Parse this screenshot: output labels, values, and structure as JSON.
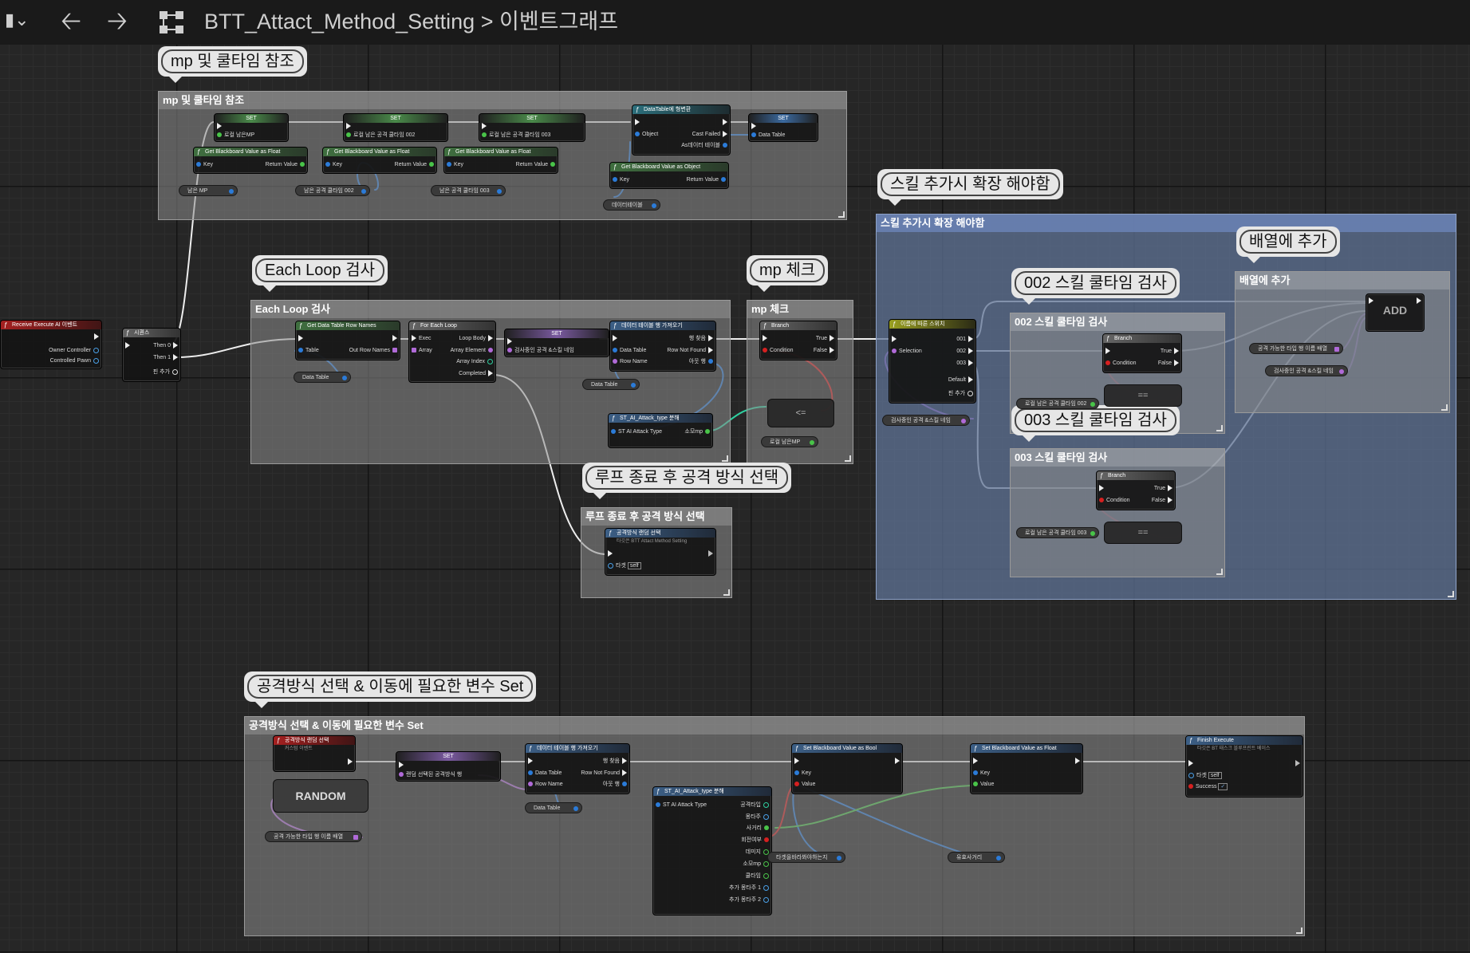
{
  "header": {
    "bookmark_icon": "bookmark-icon",
    "back_icon": "arrow-left-icon",
    "forward_icon": "arrow-right-icon",
    "graph_icon": "graph-icon",
    "breadcrumb_root": "BTT_Attact_Method_Setting",
    "breadcrumb_sep": ">",
    "breadcrumb_current": "이벤트그래프"
  },
  "comments": {
    "mp": "mp 및 쿨타임 참조",
    "each_loop": "Each Loop 검사",
    "mp_check": "mp 체크",
    "skill_extend": "스킬 추가시 확장 해야함",
    "add_array": "배열에 추가",
    "skill002": "002 스킬 쿨타임 검사",
    "skill003": "003 스킬 쿨타임 검사",
    "loop_end": "루프 종료 후 공격 방식 선택",
    "bottom": "공격방식 선택 & 이동에 필요한 변수 Set"
  },
  "nodes": {
    "receive_event": "Receive Execute AI 이벤트",
    "owner_controller": "Owner Controller",
    "controlled_pawn": "Controlled Pawn",
    "sequence": "시퀀스",
    "then0": "Then 0",
    "then1": "Then 1",
    "add_pin": "핀 추가",
    "set": "SET",
    "set_hp": "로컬 남은MP",
    "set_cd002": "로컬 남은 공격 쿨타임 002",
    "set_cd003": "로컬 남은 공격 쿨타임 003",
    "get_bb_float": "Get Blackboard Value as Float",
    "get_bb_object": "Get Blackboard Value as Object",
    "key": "Key",
    "return_value": "Return Value",
    "var_mp": "남은 MP",
    "var_cd002": "남은 공격 쿨타임 002",
    "var_cd003": "남은 공격 쿨타임 003",
    "var_dt": "데이터테이블",
    "cast_dt": "DataTable에 형변환",
    "object": "Object",
    "cast_failed": "Cast Failed",
    "as_dt": "As데이터 테이블",
    "data_table": "Data Table",
    "get_row_names": "Get Data Table Row Names",
    "table": "Table",
    "out_row_names": "Out Row Names",
    "for_each": "For Each Loop",
    "exec": "Exec",
    "array": "Array",
    "loop_body": "Loop Body",
    "array_element": "Array Element",
    "array_index": "Array Index",
    "completed": "Completed",
    "set_check_type": "검사중인 공격 &스킬 네임",
    "get_dt_row": "데이터 테이블 행 가져오기",
    "row_found": "행 찾음",
    "row_not_found": "Row Not Found",
    "row_name": "Row Name",
    "out_row": "아웃 행",
    "break_struct": "ST_AI_Attack_type 분해",
    "st_attack_type": "ST AI Attack Type",
    "mp_cost": "소모mp",
    "branch": "Branch",
    "condition": "Condition",
    "true_pin": "True",
    "false_pin": "False",
    "op_le": "<=",
    "op_eq": "==",
    "switch_on_name": "이름에 따른 스위치",
    "selection": "Selection",
    "case001": "001",
    "case002": "002",
    "case003": "003",
    "default": "Default",
    "var_check_name": "검사중인 공격 &스킬 네임",
    "add_node": "ADD",
    "var_type_array": "공격 가능한 타입 행 이름 배열",
    "var_skill_name": "검사중인 공격 &스킬 네임",
    "var_local002": "로컬 남은 공격 쿨타임 002",
    "var_local003": "로컬 남은 공격 쿨타임 003",
    "zero": "0.0",
    "choose_attack": "공격방식 랜덤 선택",
    "target_label": "타겟",
    "self_label": "self",
    "func_sub": "타깃은 BTT Attact Method Setting",
    "custom_event": "커스텀 이벤트",
    "random": "RANDOM",
    "set_random": "랜덤 선택된 공격방식 행",
    "set_bb_bool": "Set Blackboard Value as Bool",
    "set_bb_float": "Set Blackboard Value as Float",
    "value": "Value",
    "finish_execute": "Finish Execute",
    "finish_sub": "타깃은 BT 태스크 블루프린트 베이스",
    "success": "Success",
    "attack_type": "공격타입",
    "weight": "몽타주",
    "range": "사거리",
    "rotate": "회전여부",
    "damage": "데미지",
    "mpcost": "소모mp",
    "cooltime": "쿨타임",
    "extra1": "추가 몽타주 1",
    "extra2": "추가 몽타주 2",
    "var_target_rotate": "타겟을바라봐야하는지",
    "var_valid_range": "유효사거리"
  }
}
